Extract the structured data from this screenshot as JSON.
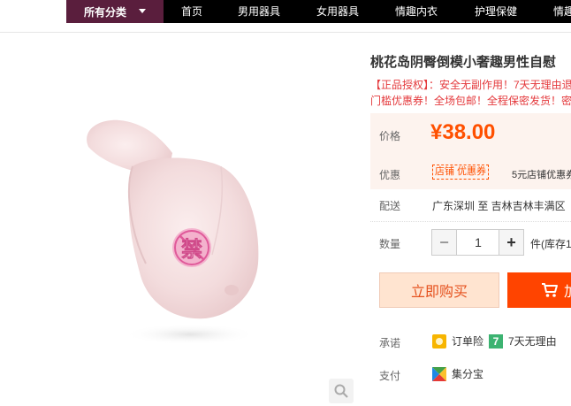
{
  "nav": {
    "all_categories": "所有分类",
    "items": [
      "首页",
      "男用器具",
      "女用器具",
      "情趣内衣",
      "护理保健",
      "情趣"
    ]
  },
  "product": {
    "title": "桃花岛阴臀倒模小奢趣男性自慰",
    "subtitle_line1": "【正品授权】：安全无副作用！7天无理由退",
    "subtitle_line2": "门槛优惠券！全场包邮！全程保密发货！密",
    "censor_char": "禁"
  },
  "price": {
    "label": "价格",
    "value": "¥38.00"
  },
  "promo": {
    "label": "优惠",
    "tag": "店铺 优惠券",
    "text": "5元店铺优惠券"
  },
  "shipping": {
    "label": "配送",
    "text": "广东深圳 至  吉林吉林丰满区"
  },
  "quantity": {
    "label": "数量",
    "minus": "−",
    "plus": "+",
    "value": "1",
    "stock_text": "件(库存1"
  },
  "actions": {
    "buy_now": "立即购买",
    "add_to_cart": "加"
  },
  "guarantee": {
    "label": "承诺",
    "items": [
      "订单险",
      "7天无理由"
    ],
    "seven_day_badge": "7"
  },
  "payment": {
    "label": "支付",
    "items": [
      "集分宝"
    ]
  },
  "colors": {
    "nav_accent": "#5a1e3d",
    "price": "#ff5000",
    "cart_button": "#ff4400",
    "buy_button_bg": "#ffe4d0"
  }
}
